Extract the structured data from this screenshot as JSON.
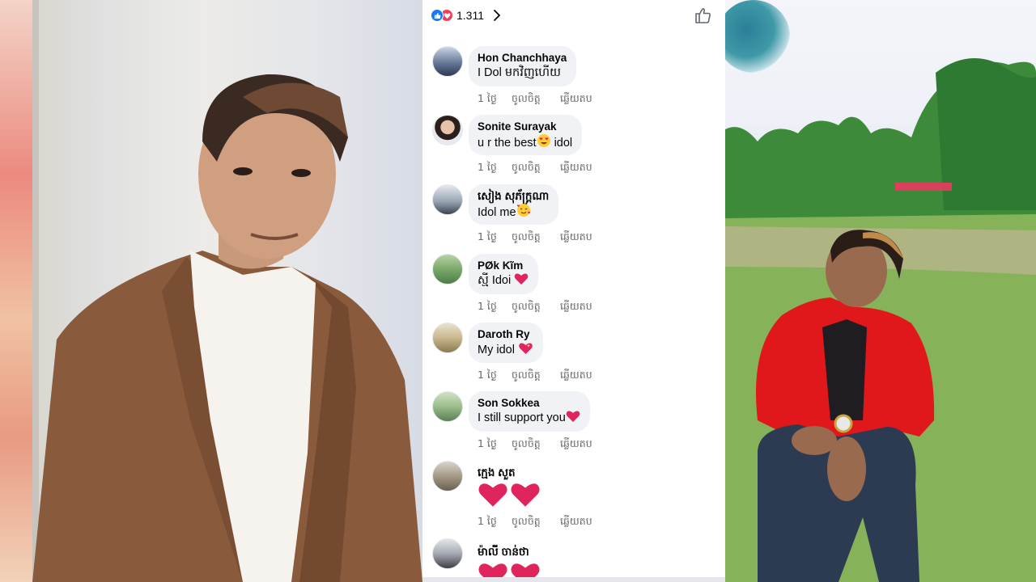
{
  "reactions": {
    "count": "1.311"
  },
  "comments": [
    {
      "name": "Hon Chanchhaya",
      "text": "I Dol មកវិញហើយ",
      "emoji": "",
      "time": "1 ថ្ងៃ",
      "like": "ចូលចិត្ត",
      "reply": "ឆ្លើយតប"
    },
    {
      "name": "Sonite Surayak",
      "text": "u r the best",
      "emoji": "heart-eyes",
      "text_after": " idol",
      "time": "1 ថ្ងៃ",
      "like": "ចូលចិត្ត",
      "reply": "ឆ្លើយតប"
    },
    {
      "name": "សៀង សុភ័ក្រ្តណា",
      "text": "Idol me",
      "emoji": "hearts-face",
      "time": "1 ថ្ងៃ",
      "like": "ចូលចិត្ត",
      "reply": "ឆ្លើយតប"
    },
    {
      "name": "PØk Kĩm",
      "text": "ស្មី  Idoi ",
      "emoji": "red-heart",
      "time": "1 ថ្ងៃ",
      "like": "ចូលចិត្ត",
      "reply": "ឆ្លើយតប"
    },
    {
      "name": "Daroth Ry",
      "text": "My idol ",
      "emoji": "heart-sparkle",
      "time": "1 ថ្ងៃ",
      "like": "ចូលចិត្ត",
      "reply": "ឆ្លើយតប"
    },
    {
      "name": "Son Sokkea",
      "text": "I still support you",
      "emoji": "red-heart",
      "time": "1 ថ្ងៃ",
      "like": "ចូលចិត្ត",
      "reply": "ឆ្លើយតប"
    },
    {
      "name": "ក្មេង សួត",
      "text": "",
      "emoji": "two-big-hearts",
      "time": "1 ថ្ងៃ",
      "like": "ចូលចិត្ត",
      "reply": "ឆ្លើយតប"
    },
    {
      "name": "ម៉ាលី ចាន់ថា",
      "text": "",
      "emoji": "two-big-hearts"
    }
  ],
  "colors": {
    "like_blue": "#1877f2",
    "love_red": "#f33e58",
    "bubble_bg": "#f0f2f5",
    "meta_gray": "#65676b"
  }
}
